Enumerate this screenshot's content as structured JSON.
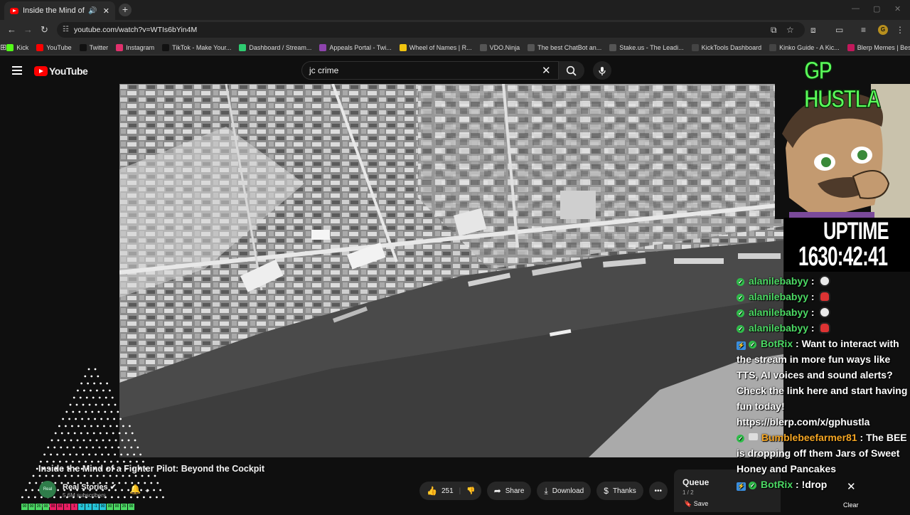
{
  "browser": {
    "tab_title": "Inside the Mind of a Fighter",
    "url": "youtube.com/watch?v=WTIs6bYin4M",
    "bookmarks": [
      "Kick",
      "YouTube",
      "Twitter",
      "Instagram",
      "TikTok - Make Your...",
      "Dashboard / Stream...",
      "Appeals Portal - Twi...",
      "Wheel of Names | R...",
      "VDO.Ninja",
      "The best ChatBot an...",
      "Stake.us - The Leadi...",
      "KickTools Dashboard",
      "Kinko Guide - A Kic...",
      "Blerp Memes | Best..."
    ],
    "bookmark_colors": [
      "#53fc18",
      "#ff0000",
      "#111111",
      "#e1306c",
      "#111111",
      "#2ecc71",
      "#8e44ad",
      "#f1c40f",
      "#555555",
      "#555555",
      "#555555",
      "#444444",
      "#444444",
      "#c2185b"
    ],
    "profile_initial": "G"
  },
  "youtube": {
    "logo": "YouTube",
    "search_query": "jc crime",
    "video_title": "Inside the Mind of a Fighter Pilot: Beyond the Cockpit",
    "channel_name": "Real Stories",
    "channel_avatar_text": "Real Stories",
    "subscribers": "5.6M subscribers",
    "likes": "251",
    "share_label": "Share",
    "download_label": "Download",
    "thanks_label": "Thanks",
    "more_label": "•••",
    "queue_title": "Queue",
    "queue_count": "1 / 2",
    "save_label": "Save",
    "clear_label": "Clear"
  },
  "overlay": {
    "streamer": "GP HUSTLA",
    "uptime_label": "UPTIME",
    "uptime_value": "1630:42:41",
    "chat": [
      {
        "user": "alanilebabyy",
        "text": ""
      },
      {
        "user": "alanilebabyy",
        "text": ""
      },
      {
        "user": "alanilebabyy",
        "text": ""
      },
      {
        "user": "alanilebabyy",
        "text": ""
      },
      {
        "user": "BotRix",
        "text": "Want to interact with the stream in more fun ways like TTS, AI voices and sound alerts? Check the link here and start having fun today! https://blerp.com/x/gphustla"
      },
      {
        "user": "Bumblebeefarmer81",
        "text": "The BEE is dropping off them Jars of Sweet Honey and Pancakes"
      },
      {
        "user": "BotRix",
        "text": "!drop"
      }
    ]
  },
  "icons": {
    "tab_audio": "speaker-icon",
    "search": "search-icon",
    "mic": "microphone-icon",
    "like": "thumbs-up-icon",
    "dislike": "thumbs-down-icon",
    "share": "share-icon",
    "download": "download-icon",
    "thanks": "thanks-icon",
    "bell": "bell-icon",
    "save": "bookmark-icon",
    "close": "close-icon"
  },
  "colors": {
    "youtube_red": "#ff0000",
    "overlay_green": "#5bff5b",
    "chat_user_green": "#4cd964",
    "chat_user_orange": "#f5a623"
  },
  "bottom_bar_squares": [
    "00",
    "00",
    "25",
    "00",
    "00",
    "00",
    "1",
    "1",
    "-2",
    "1",
    "-1",
    "00",
    "00",
    "00",
    "25",
    "00"
  ]
}
